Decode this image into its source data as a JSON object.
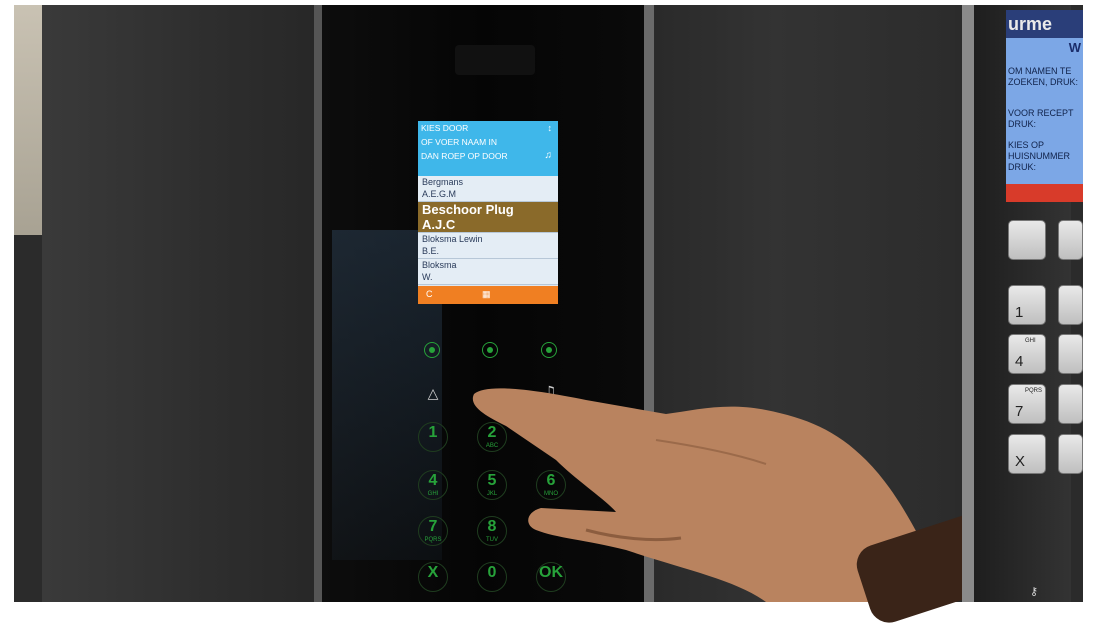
{
  "screen": {
    "header_lines": [
      "KIES DOOR",
      "OF VOER NAAM IN",
      "DAN ROEP OP DOOR"
    ],
    "arrows_icon": "updown-arrows-icon",
    "bell_icon": "bell-icon",
    "entries": [
      {
        "name": "Bergmans",
        "initials": "A.E.G.M"
      },
      {
        "name": "Beschoor Plug",
        "initials": "A.J.C"
      },
      {
        "name": "Bloksma Lewin",
        "initials": "B.E."
      },
      {
        "name": "Bloksma",
        "initials": "W."
      }
    ],
    "selected_index": 1,
    "footer_left": "C",
    "footer_right": "▦"
  },
  "keypad": {
    "nav_up": "△",
    "nav_bell": "♫",
    "keys": [
      {
        "digit": "1",
        "letters": ""
      },
      {
        "digit": "2",
        "letters": "ABC"
      },
      {
        "digit": "4",
        "letters": "GHI"
      },
      {
        "digit": "5",
        "letters": "JKL"
      },
      {
        "digit": "6",
        "letters": "MNO"
      },
      {
        "digit": "7",
        "letters": "PQRS"
      },
      {
        "digit": "8",
        "letters": "TUV"
      },
      {
        "digit": "X",
        "letters": ""
      },
      {
        "digit": "0",
        "letters": ""
      },
      {
        "digit": "OK",
        "letters": ""
      }
    ]
  },
  "right_panel": {
    "brand": "urme",
    "brand2": "W",
    "lines": [
      "OM NAMEN TE ZOEKEN, DRUK:",
      "VOOR RECEPT DRUK:",
      "KIES OP HUISNUMMER DRUK:"
    ],
    "keys": [
      {
        "digit": "1",
        "letters": ""
      },
      {
        "digit": "4",
        "letters": "GHI"
      },
      {
        "digit": "7",
        "letters": "PQRS"
      },
      {
        "digit": "X",
        "letters": ""
      }
    ]
  },
  "colors": {
    "screen_header": "#3fb7ea",
    "screen_selected": "#8a6a2a",
    "screen_footer": "#f07f22",
    "key_green": "#27a23a"
  }
}
